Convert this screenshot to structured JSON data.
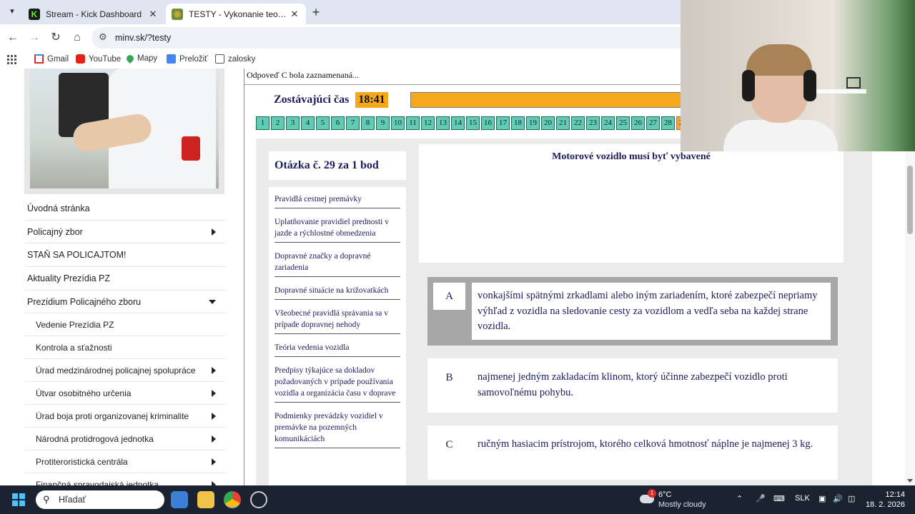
{
  "browser": {
    "tabs": [
      {
        "title": "Stream - Kick Dashboard",
        "active": false
      },
      {
        "title": "TESTY - Vykonanie teoretickej s",
        "active": true
      }
    ],
    "url": "minv.sk/?testy",
    "bookmarks": [
      {
        "label": "Gmail"
      },
      {
        "label": "YouTube"
      },
      {
        "label": "Mapy"
      },
      {
        "label": "Preložiť"
      },
      {
        "label": "zalosky"
      }
    ]
  },
  "sidebar": {
    "menu": [
      {
        "label": "Úvodná stránka",
        "has_arrow": false
      },
      {
        "label": "Policajný zbor",
        "has_arrow": true
      },
      {
        "label": "STAŇ SA POLICAJTOM!",
        "has_arrow": false
      },
      {
        "label": "Aktuality Prezídia PZ",
        "has_arrow": false
      },
      {
        "label": "Prezídium Policajného zboru",
        "has_arrow": true,
        "expanded": true
      },
      {
        "label": "Vedenie Prezídia PZ",
        "sub": true,
        "has_arrow": false
      },
      {
        "label": "Kontrola a sťažnosti",
        "sub": true,
        "has_arrow": false
      },
      {
        "label": "Úrad medzinárodnej policajnej spolupráce",
        "sub": true,
        "has_arrow": true
      },
      {
        "label": "Útvar osobitného určenia",
        "sub": true,
        "has_arrow": true
      },
      {
        "label": "Úrad boja proti organizovanej kriminalite",
        "sub": true,
        "has_arrow": true
      },
      {
        "label": "Národná protidrogová jednotka",
        "sub": true,
        "has_arrow": true
      },
      {
        "label": "Protiteroristická centrála",
        "sub": true,
        "has_arrow": true
      },
      {
        "label": "Finančná spravodajská jednotka",
        "sub": true,
        "has_arrow": true
      }
    ]
  },
  "test": {
    "previous_answer_note": "Odpoveď C bola zaznamenaná...",
    "timer_label": "Zostávajúci čas",
    "timer_value": "18:41",
    "question_numbers": [
      "1",
      "2",
      "3",
      "4",
      "5",
      "6",
      "7",
      "8",
      "9",
      "10",
      "11",
      "12",
      "13",
      "14",
      "15",
      "16",
      "17",
      "18",
      "19",
      "20",
      "21",
      "22",
      "23",
      "24",
      "25",
      "26",
      "27",
      "28",
      "29"
    ],
    "current_question": "29",
    "question_title": "Otázka č. 29 za 1 bod",
    "categories": [
      "Pravidlá cestnej premávky",
      "Uplatňovanie pravidiel prednosti v jazde a rýchlostné obmedzenia",
      "Dopravné značky a dopravné zariadenia",
      "Dopravné situácie na križovatkách",
      "Všeobecné pravidlá správania sa v prípade dopravnej nehody",
      "Teória vedenia vozidla",
      "Predpisy týkajúce sa dokladov požadovaných v prípade používania vozidla a organizácia času v doprave",
      "Podmienky prevádzky vozidiel v premávke na pozemných komunikáciách"
    ],
    "question_text": "Motorové vozidlo musí byť vybavené",
    "answers": [
      {
        "letter": "A",
        "text": "vonkajšími spätnými zrkadlami alebo iným zariadením, ktoré zabezpečí nepriamy výhľad z vozidla na sledovanie cesty za vozidlom a vedľa seba na každej strane vozidla.",
        "selected": true
      },
      {
        "letter": "B",
        "text": "najmenej jedným zakladacím klinom, ktorý účinne zabezpečí vozidlo proti samovoľnému pohybu.",
        "selected": false
      },
      {
        "letter": "C",
        "text": "ručným hasiacim prístrojom, ktorého celková hmotnosť náplne je najmenej 3 kg.",
        "selected": false
      }
    ]
  },
  "taskbar": {
    "search_placeholder": "Hľadať",
    "weather_badge": "1",
    "temperature": "6°C",
    "weather": "Mostly cloudy",
    "language": "SLK",
    "time": "12:14",
    "date": "18. 2. 2026"
  },
  "colors": {
    "accent_orange": "#f5a81c",
    "question_num_teal": "#61cbb4",
    "navy_text": "#1b1b5c",
    "taskbar": "#1c2330"
  }
}
